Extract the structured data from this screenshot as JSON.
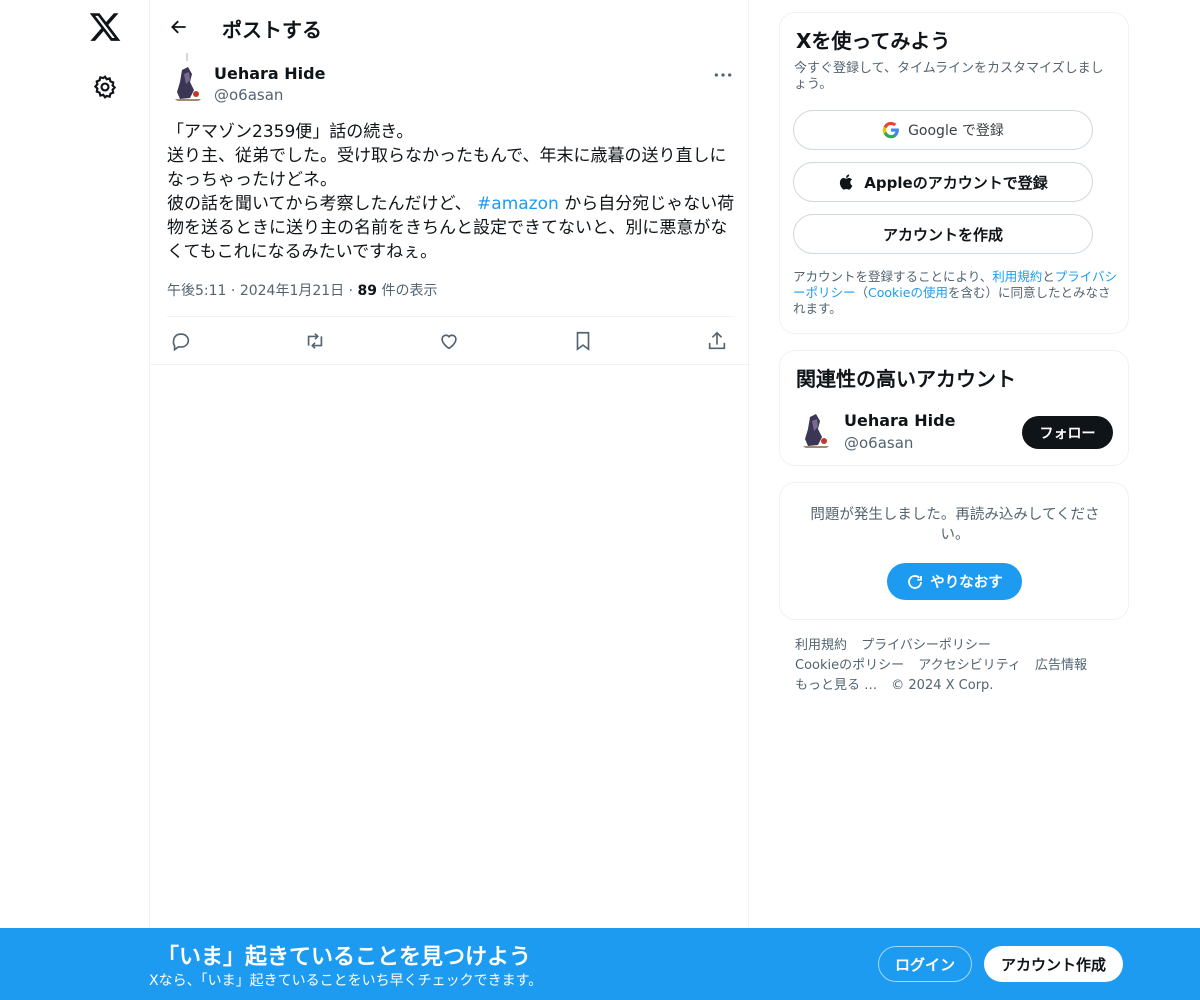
{
  "nav": {
    "logo_icon": "x-logo-icon",
    "settings_icon": "gear-icon"
  },
  "header": {
    "title": "ポストする",
    "back_icon": "arrow-left-icon"
  },
  "tweet": {
    "author_name": "Uehara Hide",
    "author_handle": "@o6asan",
    "text_lines": [
      "「アマゾン2359便」話の続き。",
      "送り主、従弟でした。受け取らなかったもんで、年末に歳暮の送り直しに",
      "なっちゃったけどネ。"
    ],
    "text_line4_before": "彼の話を聞いてから考察したんだけど、 ",
    "hashtag": "#amazon",
    "text_line4_after": " から自分宛じゃない荷",
    "text_line5": "物を送るときに送り主の名前をきちんと設定できてないと、別に悪意がな",
    "text_line6": "くてもこれになるみたいですねぇ。",
    "time": "午後5:11",
    "separator": "·",
    "date": "2024年1月21日",
    "views_count": "89",
    "views_label": "件の表示"
  },
  "actions": [
    "reply-icon",
    "retweet-icon",
    "like-icon",
    "bookmark-icon",
    "share-icon"
  ],
  "signup_card": {
    "title": "Xを使ってみよう",
    "description": "今すぐ登録して、タイムラインをカスタマイズしましょう。",
    "google_label": "Google で登録",
    "apple_label": "Appleのアカウントで登録",
    "create_label": "アカウントを作成",
    "legal_prefix": "アカウントを登録することにより、",
    "legal_terms": "利用規約",
    "legal_and": "と",
    "legal_privacy": "プライバシーポリシー",
    "legal_paren_open": "（",
    "legal_cookie": "Cookieの使用",
    "legal_suffix": "を含む）に同意したとみなされます。"
  },
  "related_card": {
    "title": "関連性の高いアカウント",
    "name": "Uehara Hide",
    "handle": "@o6asan",
    "follow_label": "フォロー"
  },
  "error_card": {
    "message": "問題が発生しました。再読み込みしてください。",
    "retry_label": "やりなおす"
  },
  "footer": {
    "terms": "利用規約",
    "privacy": "プライバシーポリシー",
    "cookie": "Cookieのポリシー",
    "accessibility": "アクセシビリティ",
    "ads": "広告情報",
    "more": "もっと見る …",
    "copyright": "© 2024 X Corp."
  },
  "banner": {
    "title": "「いま」起きていることを見つけよう",
    "subtitle": "Xなら、「いま」起きていることをいち早くチェックできます。",
    "login_label": "ログイン",
    "signup_label": "アカウント作成"
  },
  "colors": {
    "accent": "#1d9bf0",
    "text": "#0f1419",
    "muted": "#536471",
    "border": "#eff3f4"
  }
}
